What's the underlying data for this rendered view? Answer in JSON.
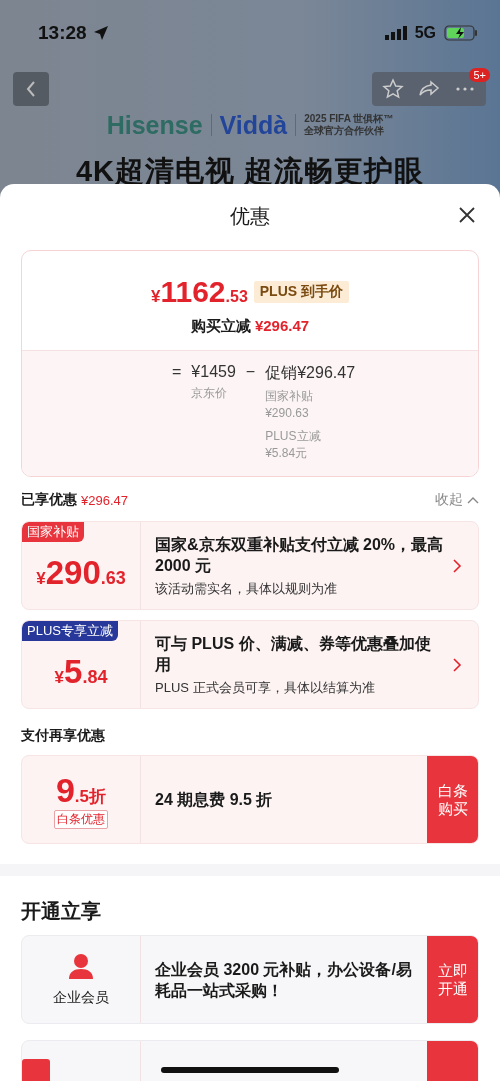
{
  "status_bar": {
    "time": "13:28",
    "network": "5G"
  },
  "nav": {
    "badge": "5+"
  },
  "banner": {
    "brand_1": "Hisense",
    "brand_2": "Viddà",
    "partner_line_1": "2025 FIFA 世俱杯™",
    "partner_line_2": "全球官方合作伙伴",
    "headline": "4K超清电视 超流畅更护眼"
  },
  "sheet": {
    "title": "优惠"
  },
  "price_card": {
    "price": {
      "currency": "¥",
      "integer": "1162",
      "decimal": ".53"
    },
    "price_badge": "PLUS 到手价",
    "instant_label": "购买立减",
    "instant_amount": "¥296.47",
    "equals": "=",
    "base_price": "¥1459",
    "base_label": "京东价",
    "minus": "−",
    "promo_total": "促销¥296.47",
    "promo_items": [
      {
        "label": "国家补贴",
        "amount": "¥290.63"
      },
      {
        "label": "PLUS立减",
        "amount": "¥5.84元"
      }
    ]
  },
  "enjoyed": {
    "label": "已享优惠",
    "amount": "¥296.47",
    "toggle": "收起"
  },
  "discounts": [
    {
      "tag": "国家补贴",
      "color": "#e8343c",
      "currency": "¥",
      "integer": "290",
      "decimal": ".63",
      "title": "国家&京东双重补贴支付立减 20%，最高 2000 元",
      "note": "该活动需实名，具体以规则为准"
    },
    {
      "tag": "PLUS专享立减",
      "color": "#27389a",
      "currency": "¥",
      "integer": "5",
      "decimal": ".84",
      "title": "可与 PLUS 价、满减、券等优惠叠加使用",
      "note": "PLUS 正式会员可享，具体以结算为准"
    }
  ],
  "payment": {
    "heading": "支付再享优惠",
    "offers": [
      {
        "kind": "rate",
        "big": "9",
        "small": ".5折",
        "tag": "白条优惠",
        "title": "24 期息费 9.5 折",
        "action": "白条购买"
      }
    ]
  },
  "open_now": {
    "heading": "开通立享",
    "offers": [
      {
        "kind": "member",
        "label": "企业会员",
        "title": "企业会员 3200 元补贴，办公设备/易耗品一站式采购！",
        "action": "立即开通"
      },
      {
        "kind": "teaser"
      }
    ]
  }
}
